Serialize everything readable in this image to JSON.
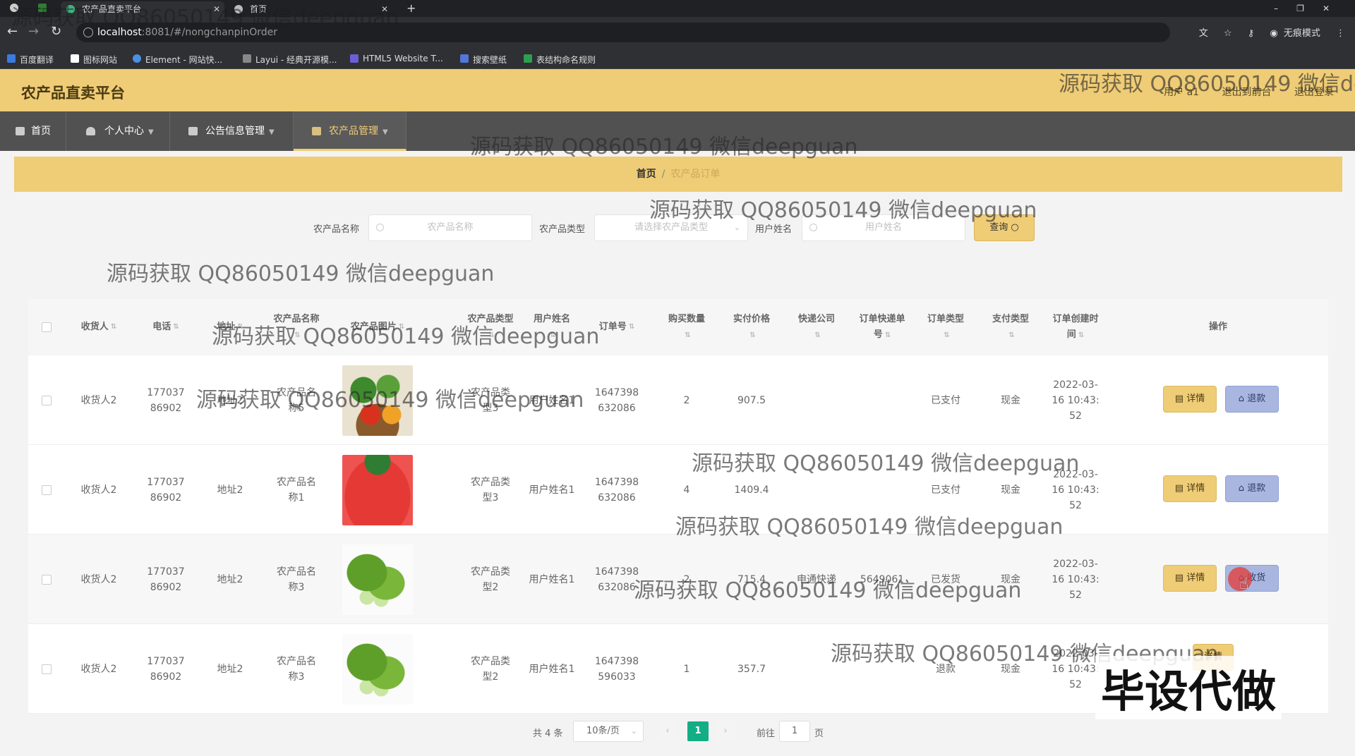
{
  "browser": {
    "tabs": [
      {
        "title": "农产品直卖平台",
        "active": true
      },
      {
        "title": "首页",
        "active": false
      }
    ],
    "new_tab": "+",
    "url_host": "localhost",
    "url_path": ":8081/#/nongchanpinOrder",
    "profile_label": "无痕模式",
    "bookmarks": [
      "百度翻译",
      "图标网站",
      "Element - 网站快...",
      "Layui - 经典开源模...",
      "HTML5 Website T...",
      "搜索壁纸",
      "表结构命名规则"
    ]
  },
  "header": {
    "brand": "农产品直卖平台",
    "user_label": "用户 a1",
    "back_label": "退出到前台",
    "logout_label": "退出登录"
  },
  "menu": [
    {
      "label": "首页",
      "caret": false,
      "active": false
    },
    {
      "label": "个人中心",
      "caret": true,
      "active": false
    },
    {
      "label": "公告信息管理",
      "caret": true,
      "active": false
    },
    {
      "label": "农产品管理",
      "caret": true,
      "active": true
    }
  ],
  "breadcrumb": {
    "home": "首页",
    "separator": "/",
    "current": "农产品订单"
  },
  "search": {
    "name_label": "农产品名称",
    "name_placeholder": "农产品名称",
    "type_label": "农产品类型",
    "type_placeholder": "请选择农产品类型",
    "user_label": "用户姓名",
    "user_placeholder": "用户姓名",
    "query_button": "查询"
  },
  "table": {
    "headers": [
      "收货人",
      "电话",
      "地址",
      "农产品名称",
      "农产品图片",
      "农产品类型",
      "用户姓名",
      "订单号",
      "购买数量",
      "实付价格",
      "快递公司",
      "订单快递单号",
      "订单类型",
      "支付类型",
      "订单创建时间",
      "操作"
    ],
    "rows": [
      {
        "receiver": "收货人2",
        "phone": "17703786902",
        "address": "地址2",
        "product": "农产品名称5",
        "image": "vegetables",
        "ptype": "农产品类型3",
        "user": "用户姓名1",
        "order_no": "1647398632086",
        "qty": "2",
        "price": "907.5",
        "express": "",
        "tracking": "",
        "status": "已支付",
        "pay": "现金",
        "created": "2022-03-16 10:43:52",
        "action1": "详情",
        "action2": "退款"
      },
      {
        "receiver": "收货人2",
        "phone": "17703786902",
        "address": "地址2",
        "product": "农产品名称1",
        "image": "strawberry",
        "ptype": "农产品类型3",
        "user": "用户姓名1",
        "order_no": "1647398632086",
        "qty": "4",
        "price": "1409.4",
        "express": "",
        "tracking": "",
        "status": "已支付",
        "pay": "现金",
        "created": "2022-03-16 10:43:52",
        "action1": "详情",
        "action2": "退款"
      },
      {
        "receiver": "收货人2",
        "phone": "17703786902",
        "address": "地址2",
        "product": "农产品名称3",
        "image": "cucumber",
        "ptype": "农产品类型2",
        "user": "用户姓名1",
        "order_no": "1647398632086",
        "qty": "2",
        "price": "715.4",
        "express": "申通快递",
        "tracking": "5649061",
        "status": "已发货",
        "pay": "现金",
        "created": "2022-03-16 10:43:52",
        "action1": "详情",
        "action2": "收货"
      },
      {
        "receiver": "收货人2",
        "phone": "17703786902",
        "address": "地址2",
        "product": "农产品名称3",
        "image": "cucumber",
        "ptype": "农产品类型2",
        "user": "用户姓名1",
        "order_no": "1647398596033",
        "qty": "1",
        "price": "357.7",
        "express": "",
        "tracking": "",
        "status": "退款",
        "pay": "现金",
        "created": "2022-03-16 10:43:52",
        "action1": "详情",
        "action2": ""
      }
    ]
  },
  "pagination": {
    "total": "共 4 条",
    "page_size": "10条/页",
    "current_page": "1",
    "goto_label": "前往",
    "goto_value": "1",
    "page_unit": "页"
  },
  "overlays": {
    "watermark": "源码获取 QQ86050149 微信deepguan",
    "watermark_partial": "源码获取 QQ86050149 微信de",
    "banner": "毕设代做"
  },
  "colors": {
    "accent": "#efcc76",
    "menu_bg": "#515151",
    "refund_button": "#a9b7e0",
    "pager_active": "#13ae85"
  }
}
